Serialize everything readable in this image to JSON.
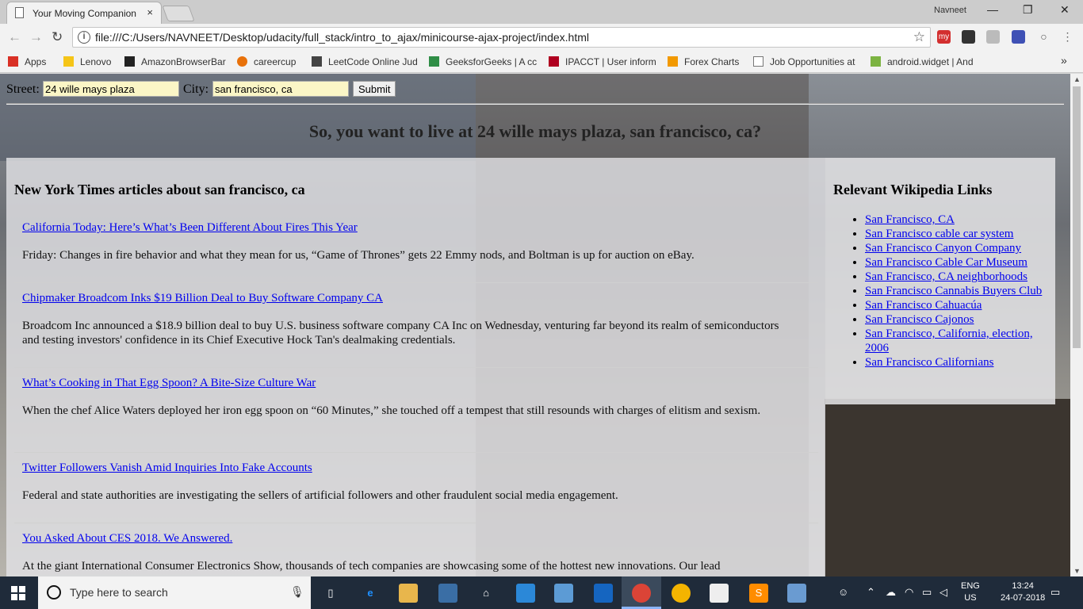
{
  "browser": {
    "tab_title": "Your Moving Companion",
    "tab_close": "×",
    "user": "Navneet",
    "minimize": "—",
    "maximize": "❐",
    "close": "✕",
    "url": "file:///C:/Users/NAVNEET/Desktop/udacity/full_stack/intro_to_ajax/minicourse-ajax-project/index.html",
    "ext_my": "my"
  },
  "bookmarks": [
    {
      "label": "Apps",
      "color": "#d93025"
    },
    {
      "label": "Lenovo",
      "color": "#f5c518"
    },
    {
      "label": "AmazonBrowserBar",
      "color": "#222222"
    },
    {
      "label": "careercup",
      "color": "#e8710a"
    },
    {
      "label": "LeetCode Online Jud",
      "color": "#444444"
    },
    {
      "label": "GeeksforGeeks | A cc",
      "color": "#2f8d46"
    },
    {
      "label": "IPACCT | User inform",
      "color": "#b00020"
    },
    {
      "label": "Forex Charts",
      "color": "#f29900"
    },
    {
      "label": "Job Opportunities at",
      "color": "#777777"
    },
    {
      "label": "android.widget | And",
      "color": "#7cb342"
    }
  ],
  "bookmarks_more": "»",
  "form": {
    "street_label": "Street:",
    "street_value": "24 wille mays plaza",
    "city_label": "City:",
    "city_value": "san francisco, ca",
    "submit": "Submit"
  },
  "greeting": "So, you want to live at 24 wille mays plaza, san francisco, ca?",
  "nyt": {
    "heading": "New York Times articles about san francisco, ca",
    "articles": [
      {
        "title": "California Today: Here’s What’s Been Different About Fires This Year",
        "snippet": "Friday: Changes in fire behavior and what they mean for us, “Game of Thrones” gets 22 Emmy nods, and Boltman is up for auction on eBay."
      },
      {
        "title": "Chipmaker Broadcom Inks $19 Billion Deal to Buy Software Company CA",
        "snippet": "Broadcom Inc announced a $18.9 billion deal to buy U.S. business software company CA Inc on Wednesday, venturing far beyond its realm of semiconductors and testing investors' confidence in its Chief Executive Hock Tan's dealmaking credentials."
      },
      {
        "title": "What’s Cooking in That Egg Spoon? A Bite-Size Culture War",
        "snippet": "When the chef Alice Waters deployed her iron egg spoon on “60 Minutes,” she touched off a tempest that still resounds with charges of elitism and sexism."
      },
      {
        "title": "Twitter Followers Vanish Amid Inquiries Into Fake Accounts",
        "snippet": "Federal and state authorities are investigating the sellers of artificial followers and other fraudulent social media engagement."
      },
      {
        "title": "You Asked About CES 2018. We Answered.",
        "snippet": "At the giant International Consumer Electronics Show, thousands of tech companies are showcasing some of the hottest new innovations. Our lead"
      }
    ]
  },
  "wiki": {
    "heading": "Relevant Wikipedia Links",
    "links": [
      "San Francisco, CA",
      "San Francisco cable car system",
      "San Francisco Canyon Company",
      "San Francisco Cable Car Museum",
      "San Francisco, CA neighborhoods",
      "San Francisco Cannabis Buyers Club",
      "San Francisco Cahuacúa",
      "San Francisco Cajonos",
      "San Francisco, California, election, 2006",
      "San Francisco Californians"
    ]
  },
  "taskbar": {
    "search_placeholder": "Type here to search",
    "lang_top": "ENG",
    "lang_bottom": "US",
    "time": "13:24",
    "date": "24-07-2018"
  }
}
